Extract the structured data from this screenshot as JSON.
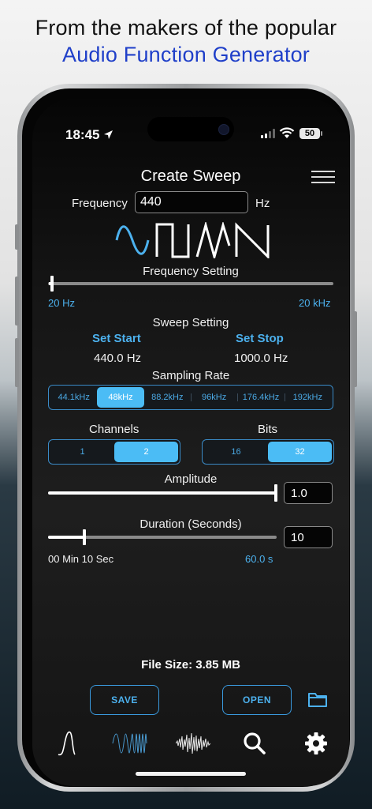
{
  "headline": {
    "line1": "From the makers of the popular",
    "line2": "Audio Function Generator"
  },
  "status_bar": {
    "time": "18:45",
    "battery": "50"
  },
  "screen_title": "Create Sweep",
  "frequency": {
    "label": "Frequency",
    "value": "440",
    "unit": "Hz"
  },
  "waveforms": [
    "sine",
    "square",
    "triangle",
    "sawtooth"
  ],
  "selected_waveform": "sine",
  "frequency_setting": {
    "label": "Frequency Setting",
    "min_label": "20 Hz",
    "max_label": "20 kHz",
    "level": 0.01
  },
  "sweep_setting": {
    "label": "Sweep Setting",
    "start_button": "Set Start",
    "stop_button": "Set Stop",
    "start_value": "440.0 Hz",
    "stop_value": "1000.0 Hz"
  },
  "sampling_rate": {
    "label": "Sampling Rate",
    "options": [
      "44.1kHz",
      "48kHz",
      "88.2kHz",
      "96kHz",
      "176.4kHz",
      "192kHz"
    ],
    "selected": "48kHz"
  },
  "channels": {
    "label": "Channels",
    "options": [
      "1",
      "2"
    ],
    "selected": "2"
  },
  "bits": {
    "label": "Bits",
    "options": [
      "16",
      "32"
    ],
    "selected": "32"
  },
  "amplitude": {
    "label": "Amplitude",
    "value": "1.0",
    "level": 1.0
  },
  "duration": {
    "label": "Duration (Seconds)",
    "value": "10",
    "level": 0.1667,
    "readout": "00 Min 10 Sec",
    "max_label": "60.0 s"
  },
  "file_size": "File Size: 3.85 MB",
  "buttons": {
    "save": "SAVE",
    "open": "OPEN"
  },
  "tab_bar": [
    "waveform-tab",
    "sweep-tab",
    "noise-tab",
    "search-tab",
    "settings-tab"
  ],
  "colors": {
    "accent": "#4cb1ee",
    "selected_segment": "#4bbcf5",
    "headline_blue": "#1f3fc9"
  }
}
